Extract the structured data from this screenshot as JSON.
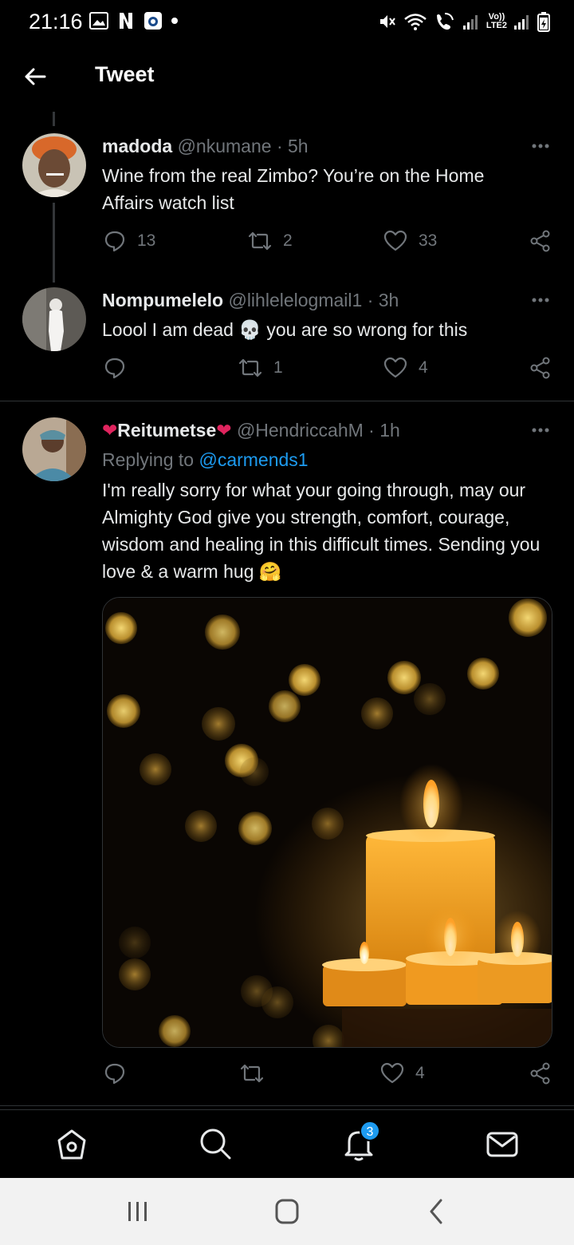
{
  "status_bar": {
    "time": "21:16",
    "left_icons": [
      "gallery-icon",
      "netflix-icon",
      "shield-app-icon",
      "dot-icon"
    ],
    "right_icons": [
      "mute-icon",
      "wifi-icon",
      "wifi-calling-icon",
      "signal-icon",
      "volte-lte2-icon",
      "signal-icon",
      "battery-icon"
    ],
    "volte_label": "Vo))",
    "lte_label": "LTE2"
  },
  "header": {
    "title": "Tweet",
    "back_icon": "arrow-left-icon"
  },
  "tweets": [
    {
      "name": "madoda",
      "handle": "@nkumane",
      "time": "5h",
      "text": "Wine from the real Zimbo? You’re on the Home Affairs watch list",
      "replies": "13",
      "retweets": "2",
      "likes": "33"
    },
    {
      "name": "Nompumelelo",
      "handle": "@lihlelelogmail1",
      "time": "3h",
      "text_before": "Loool I am dead",
      "emoji": "💀",
      "text_after": "you are so wrong for this",
      "replies": "",
      "retweets": "1",
      "likes": "4"
    },
    {
      "name_prefix": "❤",
      "name": "Reitumetse",
      "name_suffix": "❤",
      "handle": "@HendriccahM",
      "time": "1h",
      "replying_prefix": "Replying to",
      "replying_to": "@carmends1",
      "text": "I'm really sorry for what your going through, may our Almighty God give you strength, comfort, courage, wisdom and healing in this difficult times. Sending you love & a warm hug",
      "emoji": "🤗",
      "replies": "",
      "retweets": "",
      "likes": "4"
    }
  ],
  "separator": "·",
  "bottom_nav": {
    "items": [
      "home-icon",
      "search-icon",
      "notifications-icon",
      "messages-icon"
    ],
    "notifications_count": "3"
  },
  "colors": {
    "background": "#000000",
    "text": "#e7e9ea",
    "muted": "#71767b",
    "accent": "#1d9bf0",
    "heart": "#e0245e"
  }
}
